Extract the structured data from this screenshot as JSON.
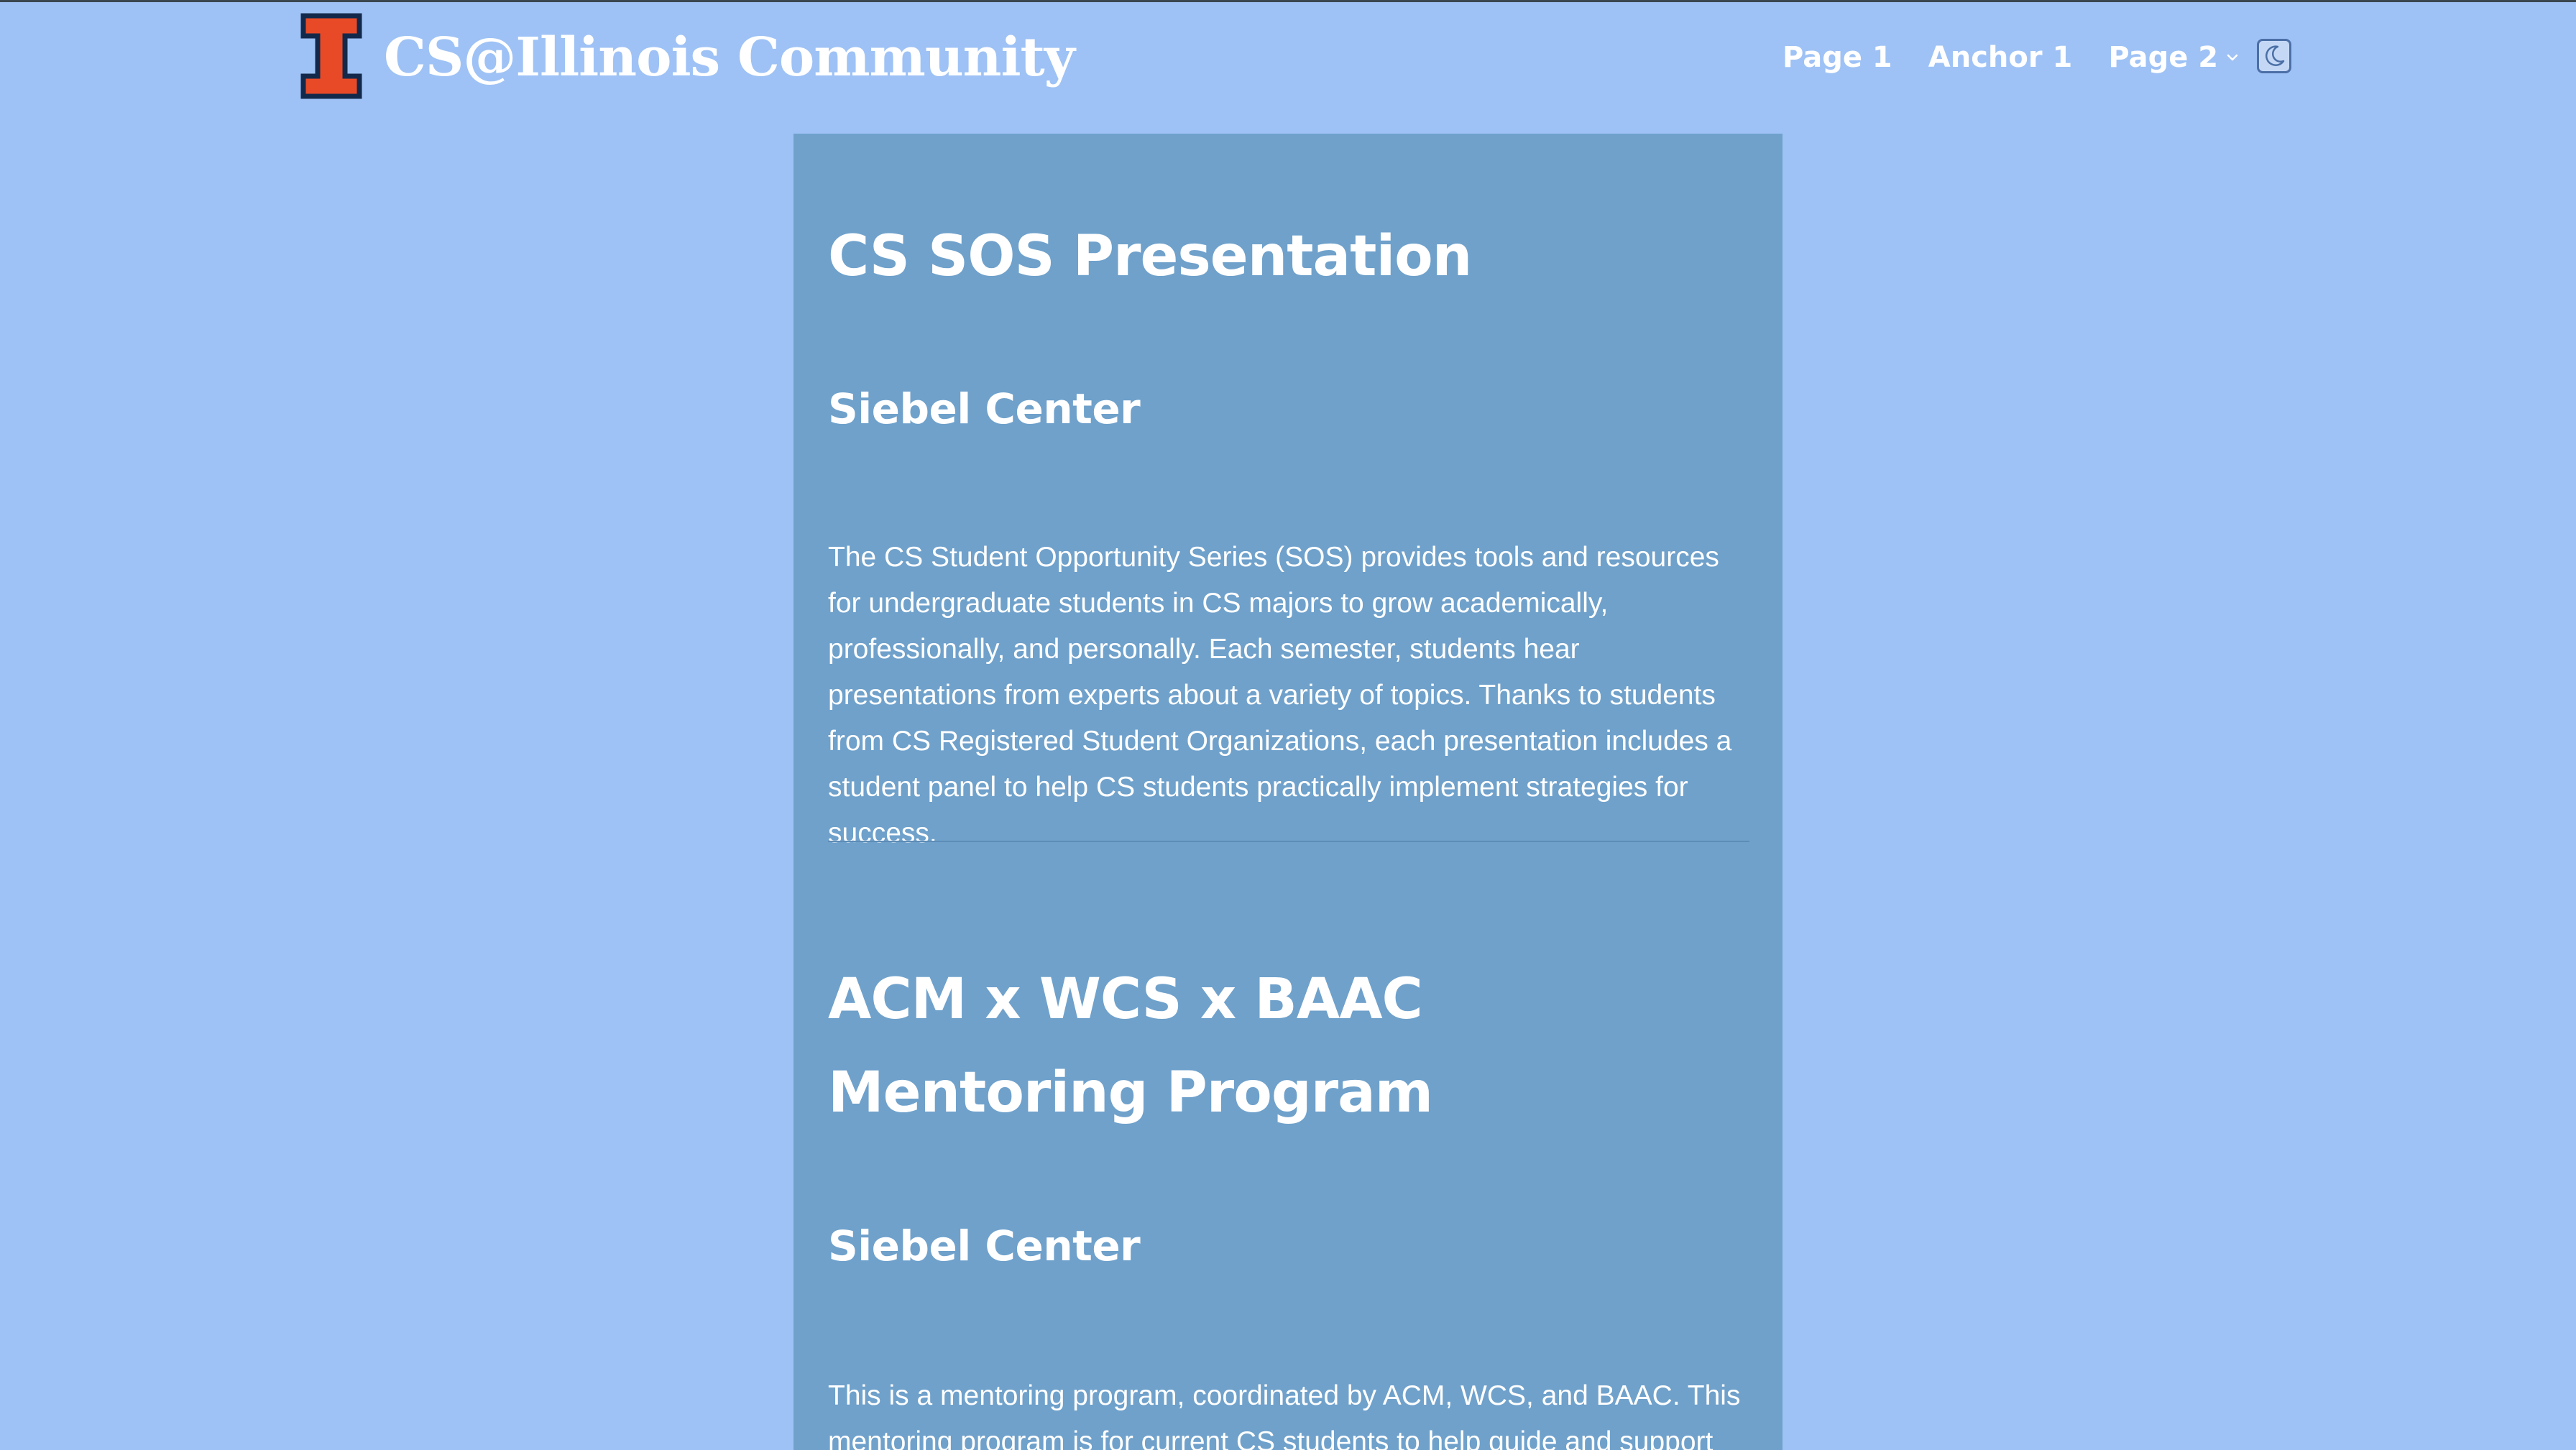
{
  "header": {
    "brand": "CS@Illinois Community",
    "logo_icon": "illinois-block-i-icon",
    "nav": [
      {
        "label": "Page 1"
      },
      {
        "label": "Anchor 1"
      },
      {
        "label": "Page 2",
        "dropdown": true
      }
    ],
    "theme_toggle_icon": "moon-icon"
  },
  "events": [
    {
      "title": "CS SOS Presentation",
      "location": "Siebel Center",
      "description": "The CS Student Opportunity Series (SOS) provides tools and resources for undergraduate students in CS majors to grow academically, professionally, and personally. Each semester, students hear presentations from experts about a variety of topics. Thanks to students from CS Registered Student Organizations, each presentation includes a student panel to help CS students practically implement strategies for success."
    },
    {
      "title": "ACM x WCS x BAAC Mentoring Program",
      "location": "Siebel Center",
      "description": "This is a mentoring program, coordinated by ACM, WCS, and BAAC. This mentoring program is for current CS students to help guide and support"
    }
  ],
  "colors": {
    "page_background": "#9ec2f5",
    "content_background": "#6fa1cb",
    "logo_orange": "#e84a27",
    "logo_navy": "#13294b",
    "text": "#ffffff"
  }
}
